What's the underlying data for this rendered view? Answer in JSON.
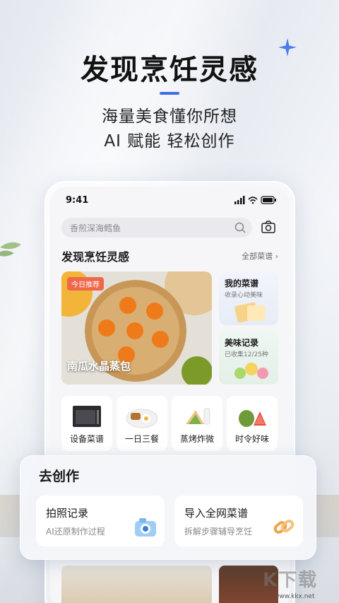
{
  "hero": {
    "title": "发现烹饪灵感",
    "subtitle1": "海量美食懂你所想",
    "subtitle2": "AI 赋能 轻松创作"
  },
  "status_bar": {
    "time": "9:41"
  },
  "search": {
    "placeholder": "香煎深海鳕鱼"
  },
  "discover": {
    "title": "发现烹饪灵感",
    "link": "全部菜谱 ›",
    "feature": {
      "badge": "今日推荐",
      "caption": "南瓜水晶蒸包"
    },
    "side_cards": [
      {
        "title": "我的菜谱",
        "subtitle": "收录心动美味"
      },
      {
        "title": "美味记录",
        "subtitle": "已收集12/25种"
      }
    ]
  },
  "categories": [
    {
      "label": "设备菜谱",
      "icon": "oven-icon"
    },
    {
      "label": "一日三餐",
      "icon": "breakfast-plate-icon"
    },
    {
      "label": "蒸烤炸微",
      "icon": "sandwich-icon"
    },
    {
      "label": "时令好味",
      "icon": "fruit-icon"
    }
  ],
  "create": {
    "title": "去创作",
    "cards": [
      {
        "title": "拍照记录",
        "subtitle": "AI还原制作过程",
        "icon": "camera-icon"
      },
      {
        "title": "导入全网菜谱",
        "subtitle": "拆解步骤辅导烹饪",
        "icon": "link-icon"
      }
    ]
  },
  "watermark": {
    "logo": "K下载",
    "url": "www.kkx.net"
  },
  "colors": {
    "accent": "#3d6ee8",
    "badge": "#f0684a",
    "sparkle": "#4a7df0"
  }
}
